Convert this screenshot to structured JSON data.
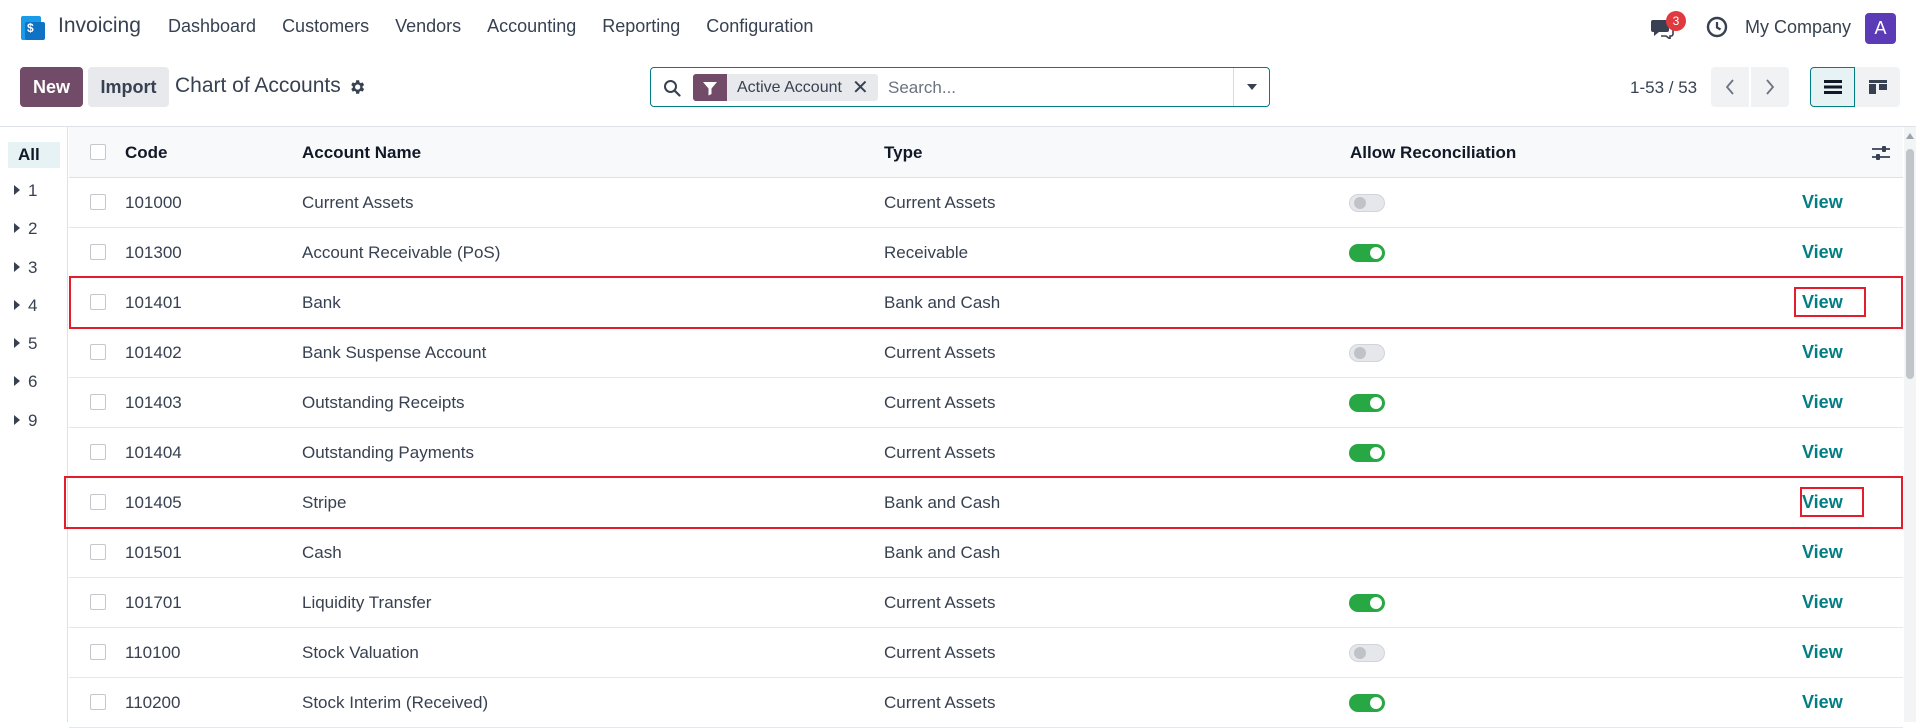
{
  "topbar": {
    "app_name": "Invoicing",
    "menu": [
      "Dashboard",
      "Customers",
      "Vendors",
      "Accounting",
      "Reporting",
      "Configuration"
    ],
    "notification_count": "3",
    "company": "My Company",
    "avatar_letter": "A"
  },
  "control_panel": {
    "new_label": "New",
    "import_label": "Import",
    "title": "Chart of Accounts",
    "search": {
      "facet_label": "Active Account",
      "placeholder": "Search..."
    },
    "pager": "1-53 / 53"
  },
  "side_panel": {
    "all_label": "All",
    "groups": [
      "1",
      "2",
      "3",
      "4",
      "5",
      "6",
      "9"
    ]
  },
  "table": {
    "columns": {
      "code": "Code",
      "name": "Account Name",
      "type": "Type",
      "reconcile": "Allow Reconciliation"
    },
    "rows": [
      {
        "code": "101000",
        "name": "Current Assets",
        "type": "Current Assets",
        "reconcile": "off",
        "action": "View"
      },
      {
        "code": "101300",
        "name": "Account Receivable (PoS)",
        "type": "Receivable",
        "reconcile": "on",
        "action": "View"
      },
      {
        "code": "101401",
        "name": "Bank",
        "type": "Bank and Cash",
        "reconcile": "none",
        "action": "View"
      },
      {
        "code": "101402",
        "name": "Bank Suspense Account",
        "type": "Current Assets",
        "reconcile": "off",
        "action": "View"
      },
      {
        "code": "101403",
        "name": "Outstanding Receipts",
        "type": "Current Assets",
        "reconcile": "on",
        "action": "View"
      },
      {
        "code": "101404",
        "name": "Outstanding Payments",
        "type": "Current Assets",
        "reconcile": "on",
        "action": "View"
      },
      {
        "code": "101405",
        "name": "Stripe",
        "type": "Bank and Cash",
        "reconcile": "none",
        "action": "View"
      },
      {
        "code": "101501",
        "name": "Cash",
        "type": "Bank and Cash",
        "reconcile": "none",
        "action": "View"
      },
      {
        "code": "101701",
        "name": "Liquidity Transfer",
        "type": "Current Assets",
        "reconcile": "on",
        "action": "View"
      },
      {
        "code": "110100",
        "name": "Stock Valuation",
        "type": "Current Assets",
        "reconcile": "off",
        "action": "View"
      },
      {
        "code": "110200",
        "name": "Stock Interim (Received)",
        "type": "Current Assets",
        "reconcile": "on",
        "action": "View"
      }
    ]
  },
  "colors": {
    "primary": "#714b67",
    "accent": "#017e84",
    "toggle_on": "#28a745",
    "highlight": "#e11d2e",
    "badge": "#e0393e"
  }
}
